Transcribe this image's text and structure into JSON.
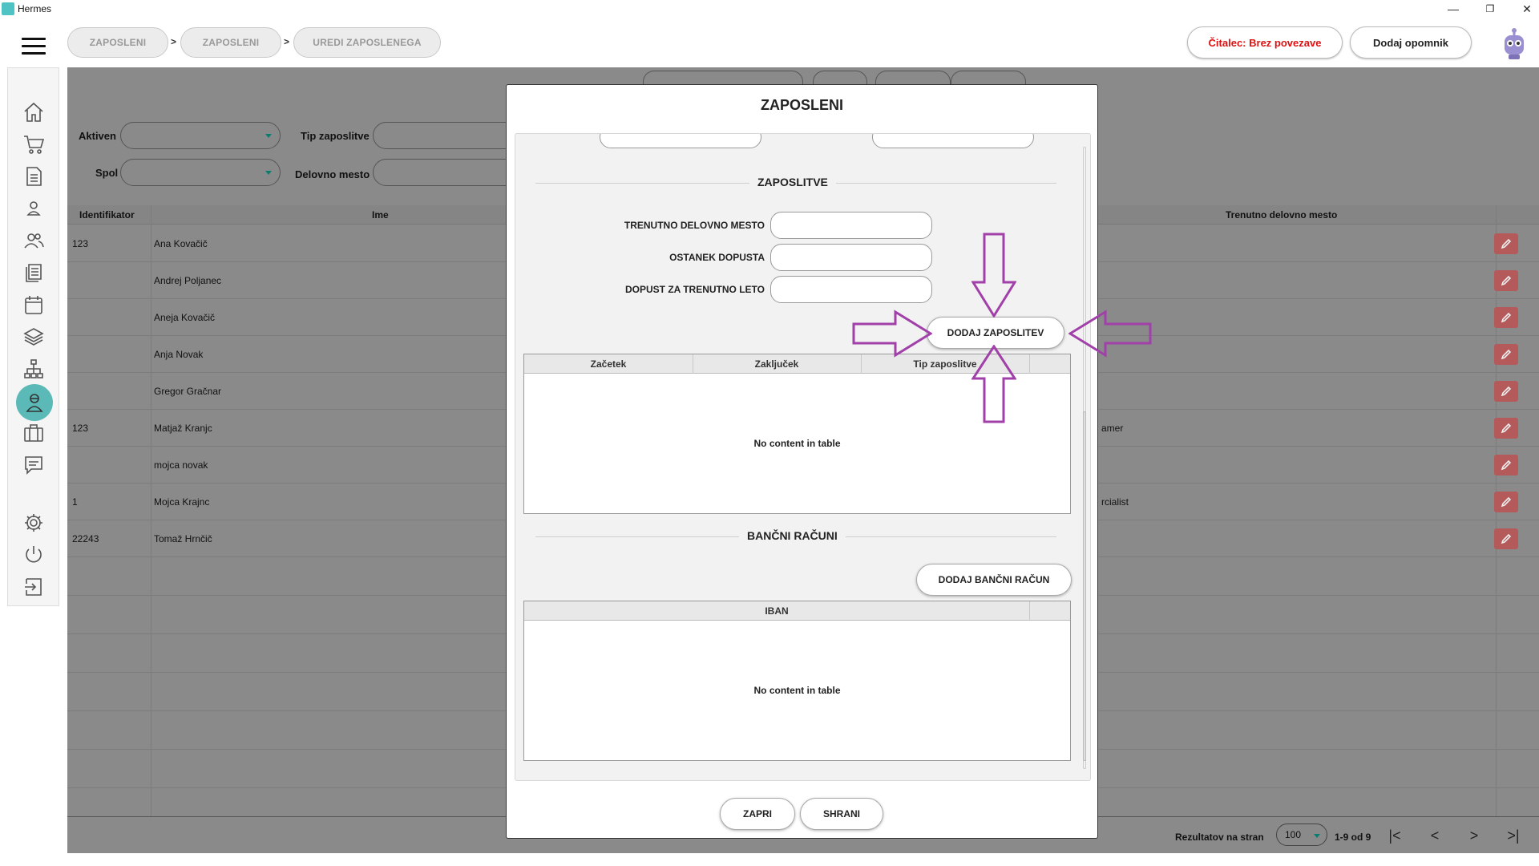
{
  "window": {
    "title": "Hermes",
    "minimize_glyph": "—",
    "restore_glyph": "❐",
    "close_glyph": "✕"
  },
  "breadcrumbs": [
    "ZAPOSLENI",
    "ZAPOSLENI",
    "UREDI ZAPOSLENEGA"
  ],
  "breadcrumb_sep": ">",
  "header": {
    "reader_status": "Čitalec: Brez povezave",
    "add_reminder": "Dodaj opomnik",
    "reader_color": "#dd1111"
  },
  "sidebar": {
    "items": [
      "home-icon",
      "cart-icon",
      "document-icon",
      "person-icon",
      "people-icon",
      "documents-icon",
      "calendar-icon",
      "layers-icon",
      "hierarchy-icon",
      "employee-icon",
      "briefcase-icon",
      "chat-icon",
      "gear-icon",
      "power-icon",
      "logout-icon"
    ],
    "active": "employee-icon",
    "active_color": "#5bbab8"
  },
  "filters": {
    "active_label": "Aktiven",
    "gender_label": "Spol",
    "employment_type_label": "Tip zaposlitve",
    "workplace_label": "Delovno mesto"
  },
  "table": {
    "columns": [
      "Identifikator",
      "Ime",
      "Trenutno delovno mesto"
    ],
    "rows": [
      {
        "id": "123",
        "name": "Ana Kovačič",
        "workplace": ""
      },
      {
        "id": "",
        "name": "Andrej Poljanec",
        "workplace": ""
      },
      {
        "id": "",
        "name": "Aneja  Kovačič",
        "workplace": ""
      },
      {
        "id": "",
        "name": "Anja Novak",
        "workplace": ""
      },
      {
        "id": "",
        "name": "Gregor Gračnar",
        "workplace": ""
      },
      {
        "id": "123",
        "name": "Matjaž Kranjc",
        "workplace": "amer"
      },
      {
        "id": "",
        "name": "mojca novak",
        "workplace": ""
      },
      {
        "id": "1",
        "name": "Mojca Krajnc",
        "workplace": "rcialist"
      },
      {
        "id": "22243",
        "name": "Tomaž Hrnčič",
        "workplace": ""
      }
    ]
  },
  "pager": {
    "results_per_page_label": "Rezultatov na stran",
    "page_size": "100",
    "range": "1-9 od 9",
    "first_glyph": "|<",
    "prev_glyph": "<",
    "next_glyph": ">",
    "last_glyph": ">|"
  },
  "modal": {
    "title": "ZAPOSLENI",
    "employments_section": "ZAPOSLITVE",
    "current_workplace_label": "TRENUTNO DELOVNO MESTO",
    "remaining_leave_label": "OSTANEK DOPUSTA",
    "leave_current_year_label": "DOPUST ZA TRENUTNO LETO",
    "add_employment_button": "DODAJ ZAPOSLITEV",
    "employment_columns": [
      "Začetek",
      "Zaključek",
      "Tip zaposlitve"
    ],
    "employment_empty": "No content in table",
    "bank_section": "BANČNI RAČUNI",
    "add_bank_button": "DODAJ BANČNI RAČUN",
    "bank_columns": [
      "IBAN"
    ],
    "bank_empty": "No content in table",
    "close_button": "ZAPRI",
    "save_button": "SHRANI"
  },
  "annotation": {
    "arrow_color": "#a040a8"
  }
}
